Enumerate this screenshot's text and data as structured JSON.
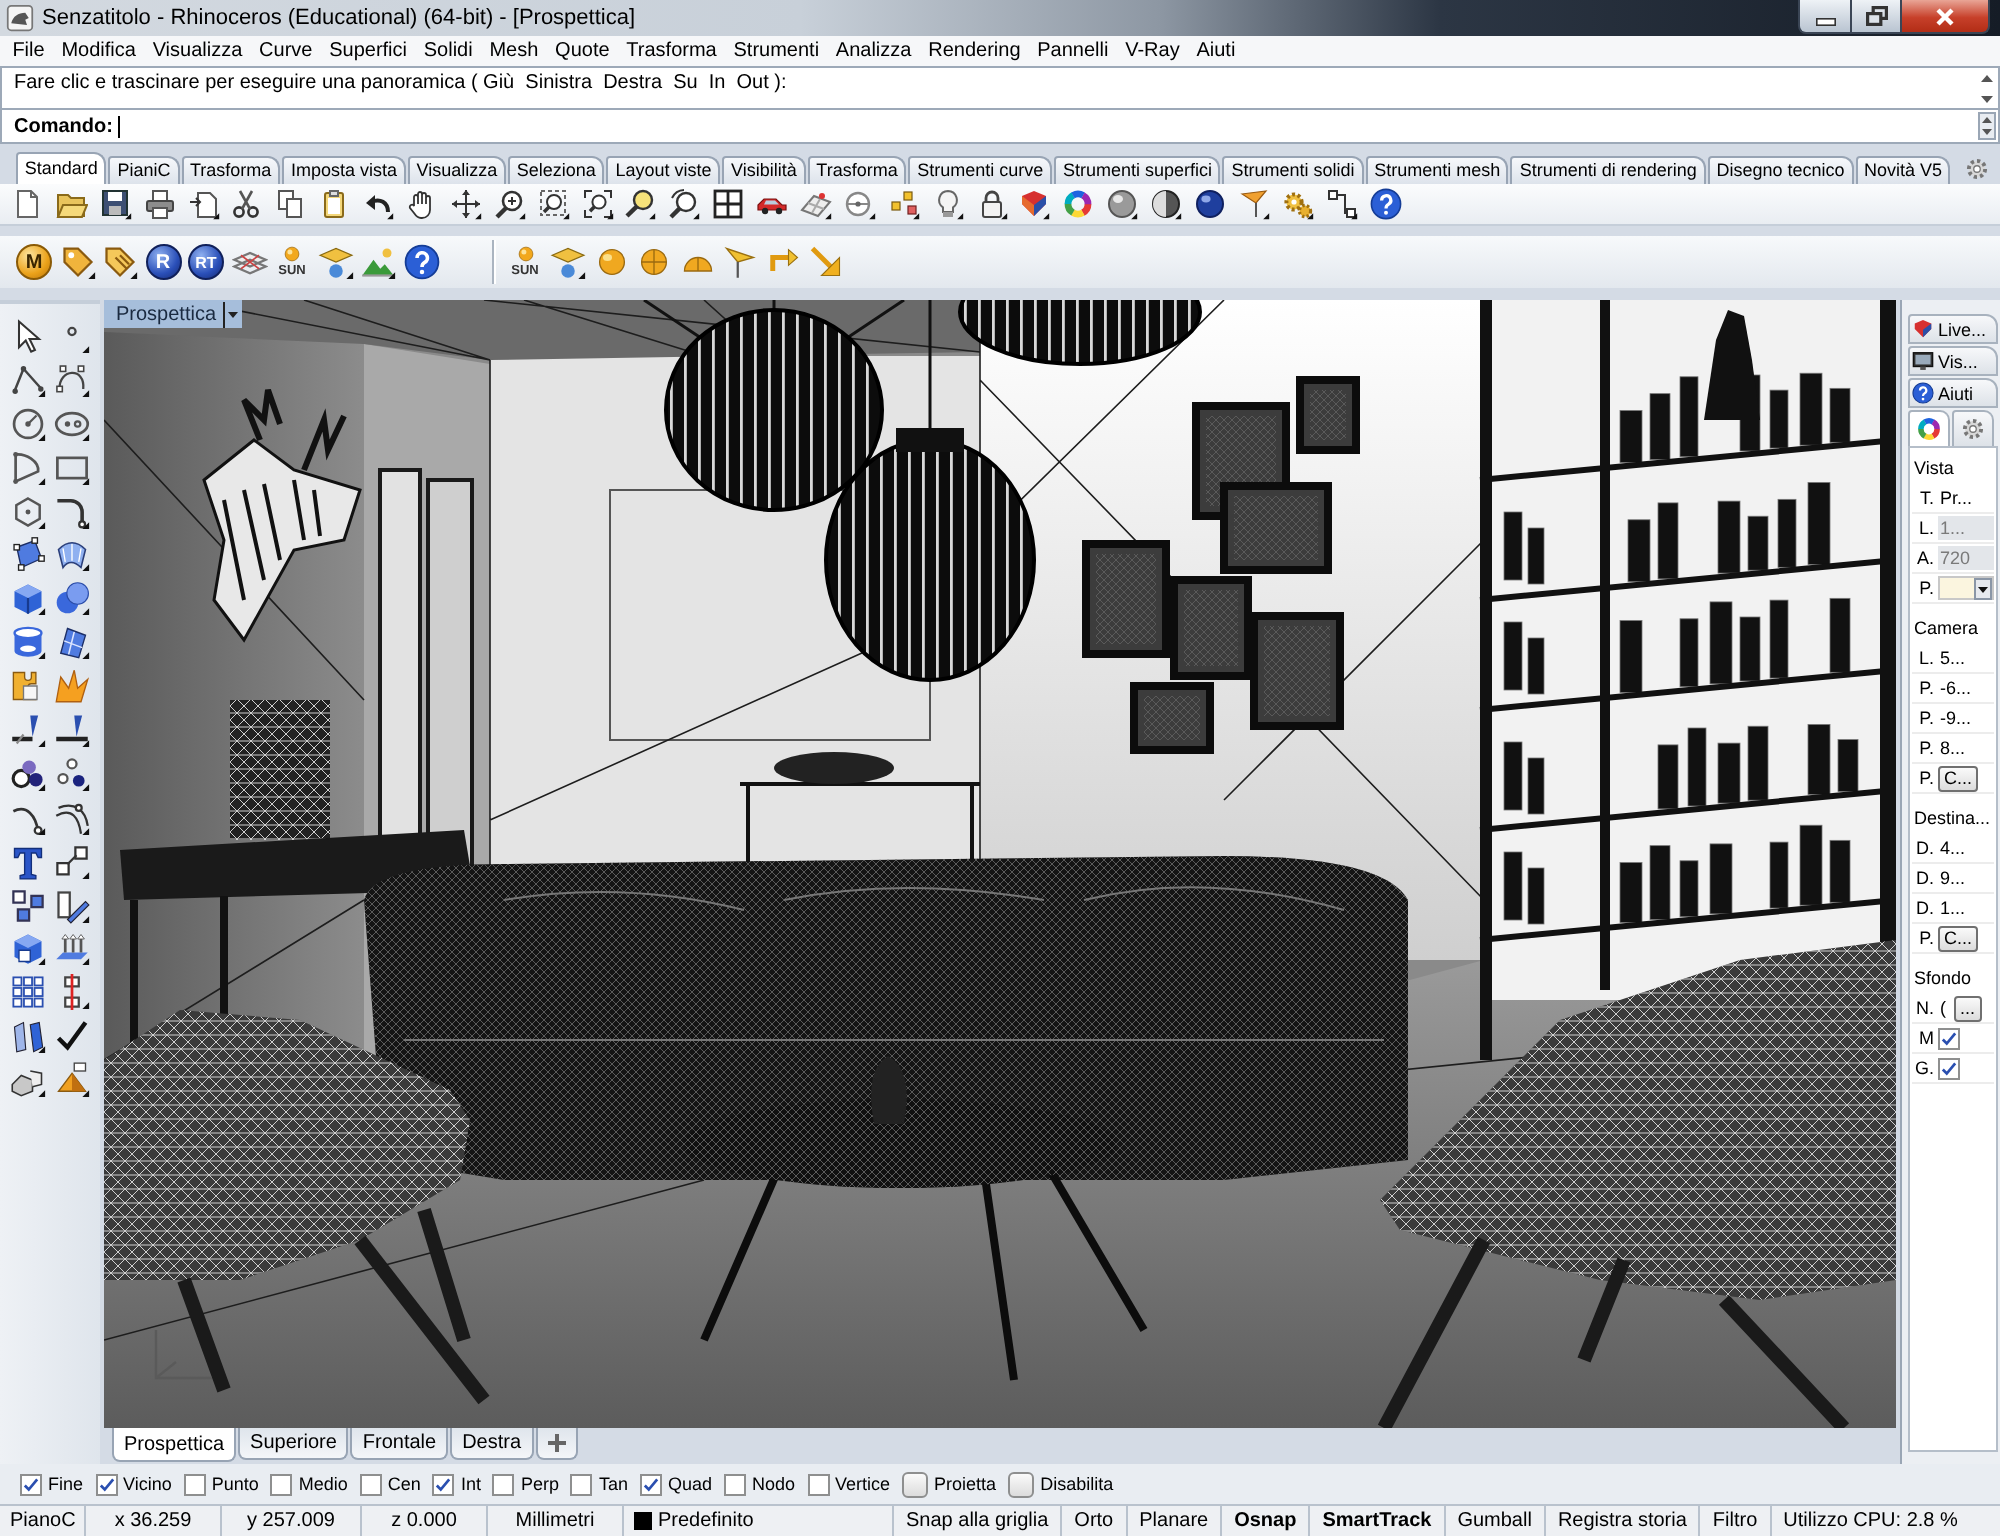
{
  "window": {
    "title": "Senzatitolo - Rhinoceros (Educational) (64-bit) - [Prospettica]"
  },
  "menu": [
    "File",
    "Modifica",
    "Visualizza",
    "Curve",
    "Superfici",
    "Solidi",
    "Mesh",
    "Quote",
    "Trasforma",
    "Strumenti",
    "Analizza",
    "Rendering",
    "Pannelli",
    "V-Ray",
    "Aiuti"
  ],
  "command_history": {
    "text": "Fare clic e trascinare per eseguire una panoramica ( Giù  Sinistra  Destra  Su  In  Out ):"
  },
  "command_prompt": {
    "label": "Comando:"
  },
  "toolbar_tabs": [
    {
      "label": "Standard",
      "selected": true
    },
    {
      "label": "PianiC",
      "selected": false
    },
    {
      "label": "Trasforma",
      "selected": false
    },
    {
      "label": "Imposta vista",
      "selected": false
    },
    {
      "label": "Visualizza",
      "selected": false
    },
    {
      "label": "Seleziona",
      "selected": false
    },
    {
      "label": "Layout viste",
      "selected": false
    },
    {
      "label": "Visibilità",
      "selected": false
    },
    {
      "label": "Trasforma",
      "selected": false
    },
    {
      "label": "Strumenti curve",
      "selected": false
    },
    {
      "label": "Strumenti superfici",
      "selected": false
    },
    {
      "label": "Strumenti solidi",
      "selected": false
    },
    {
      "label": "Strumenti mesh",
      "selected": false
    },
    {
      "label": "Strumenti di rendering",
      "selected": false
    },
    {
      "label": "Disegno tecnico",
      "selected": false
    },
    {
      "label": "Novità V5",
      "selected": false
    }
  ],
  "render_toolbar": {
    "letter_buttons": [
      "M",
      "R",
      "RT"
    ],
    "sun_buttons": [
      "SUN",
      "SUN"
    ]
  },
  "viewport": {
    "title": "Prospettica"
  },
  "viewport_tabs": [
    {
      "label": "Prospettica",
      "selected": true
    },
    {
      "label": "Superiore",
      "selected": false
    },
    {
      "label": "Frontale",
      "selected": false
    },
    {
      "label": "Destra",
      "selected": false
    }
  ],
  "side_panel": {
    "tabs": [
      {
        "label": "Live...",
        "selected": false
      },
      {
        "label": "Vis...",
        "selected": false
      },
      {
        "label": "Aiuti",
        "selected": false
      }
    ],
    "icon_tabs": [
      {
        "kind": "colorwheel",
        "selected": true
      },
      {
        "kind": "gear",
        "selected": false
      }
    ],
    "sections": [
      {
        "title": "Vista",
        "rows": [
          {
            "kind": "text",
            "label": "T.",
            "value": "Pr...",
            "disabled": false
          },
          {
            "kind": "text",
            "label": "L.",
            "value": "1...",
            "disabled": true
          },
          {
            "kind": "text",
            "label": "A.",
            "value": "720",
            "disabled": true
          },
          {
            "kind": "dropdown",
            "label": "P."
          }
        ]
      },
      {
        "title": "Camera",
        "rows": [
          {
            "kind": "text",
            "label": "L.",
            "value": "5...",
            "disabled": false
          },
          {
            "kind": "text",
            "label": "P.",
            "value": "-6...",
            "disabled": false
          },
          {
            "kind": "text",
            "label": "P.",
            "value": "-9...",
            "disabled": false
          },
          {
            "kind": "text",
            "label": "P.",
            "value": "8...",
            "disabled": false
          },
          {
            "kind": "button",
            "label": "P.",
            "button": "C..."
          }
        ]
      },
      {
        "title": "Destina...",
        "rows": [
          {
            "kind": "text",
            "label": "D.",
            "value": "4...",
            "disabled": false
          },
          {
            "kind": "text",
            "label": "D.",
            "value": "9...",
            "disabled": false
          },
          {
            "kind": "text",
            "label": "D.",
            "value": "1...",
            "disabled": false
          },
          {
            "kind": "button",
            "label": "P.",
            "button": "C..."
          }
        ]
      },
      {
        "title": "Sfondo",
        "rows": [
          {
            "kind": "textbutton",
            "label": "N.",
            "value": "(",
            "button": "..."
          },
          {
            "kind": "checkbox",
            "label": "M",
            "checked": true
          },
          {
            "kind": "checkbox",
            "label": "G.",
            "checked": true
          }
        ]
      }
    ]
  },
  "osnaps": [
    {
      "kind": "check",
      "label": "Fine",
      "checked": true
    },
    {
      "kind": "check",
      "label": "Vicino",
      "checked": true
    },
    {
      "kind": "check",
      "label": "Punto",
      "checked": false
    },
    {
      "kind": "check",
      "label": "Medio",
      "checked": false
    },
    {
      "kind": "check",
      "label": "Cen",
      "checked": false
    },
    {
      "kind": "check",
      "label": "Int",
      "checked": true
    },
    {
      "kind": "check",
      "label": "Perp",
      "checked": false
    },
    {
      "kind": "check",
      "label": "Tan",
      "checked": false
    },
    {
      "kind": "check",
      "label": "Quad",
      "checked": true
    },
    {
      "kind": "check",
      "label": "Nodo",
      "checked": false
    },
    {
      "kind": "check",
      "label": "Vertice",
      "checked": false
    },
    {
      "kind": "toggle",
      "label": "Proietta",
      "checked": false
    },
    {
      "kind": "toggle",
      "label": "Disabilita",
      "checked": false
    }
  ],
  "status_bar": {
    "info": [
      {
        "text": "PianoC"
      },
      {
        "text": "x 36.259"
      },
      {
        "text": "y 257.009"
      },
      {
        "text": "z 0.000"
      },
      {
        "text": "Millimetri"
      },
      {
        "text": "Predefinito",
        "color": "#000000"
      }
    ],
    "toggles": [
      {
        "label": "Snap alla griglia",
        "on": false
      },
      {
        "label": "Orto",
        "on": false
      },
      {
        "label": "Planare",
        "on": false
      },
      {
        "label": "Osnap",
        "on": true
      },
      {
        "label": "SmartTrack",
        "on": true
      },
      {
        "label": "Gumball",
        "on": false
      },
      {
        "label": "Registra storia",
        "on": false
      },
      {
        "label": "Filtro",
        "on": false
      }
    ],
    "cpu": "Utilizzo CPU: 2.8 %"
  }
}
